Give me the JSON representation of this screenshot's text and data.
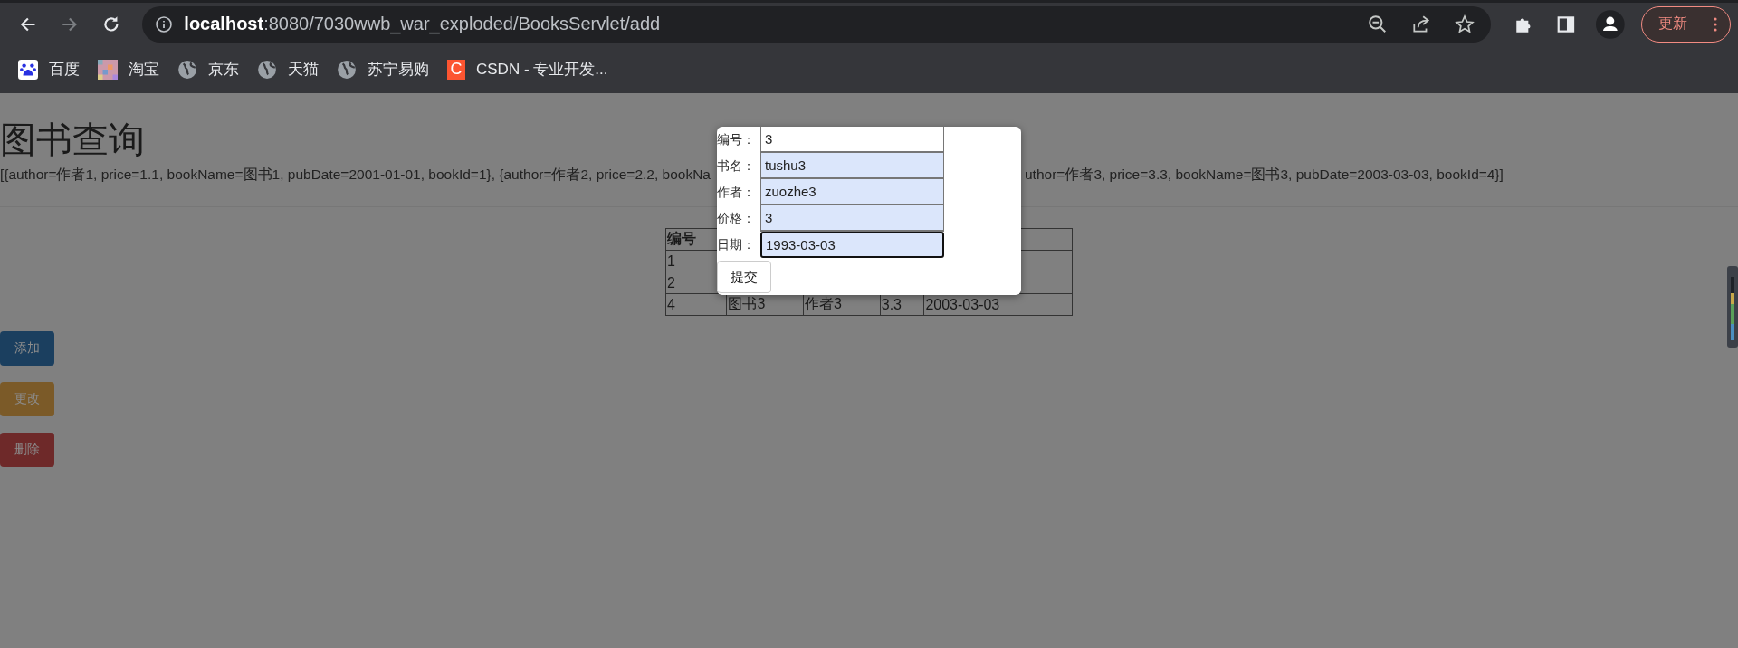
{
  "browser": {
    "nav_buttons": [
      {
        "kind": "back",
        "disabled": false
      },
      {
        "kind": "forward",
        "disabled": true
      },
      {
        "kind": "reload",
        "disabled": false
      }
    ],
    "address": {
      "host": "localhost",
      "path": ":8080/7030wwb_war_exploded/BooksServlet/add"
    },
    "update_button": "更新",
    "bookmarks": [
      {
        "kind": "paw",
        "label": "百度"
      },
      {
        "kind": "mosaic",
        "label": "淘宝"
      },
      {
        "kind": "globe",
        "label": "京东"
      },
      {
        "kind": "globe",
        "label": "天猫"
      },
      {
        "kind": "globe",
        "label": "苏宁易购"
      },
      {
        "kind": "letter",
        "icon_text": "C",
        "label": "CSDN - 专业开发..."
      }
    ]
  },
  "page": {
    "title": "图书查询",
    "list_text_left": "[{author=作者1, price=1.1, bookName=图书1, pubDate=2001-01-01, bookId=1}, {author=作者2, price=2.2, bookNa",
    "list_text_right": "uthor=作者3, price=3.3, bookName=图书3, pubDate=2003-03-03, bookId=4}]",
    "table": {
      "columns": [
        "编号"
      ],
      "rows": [
        {
          "cells": [
            "1"
          ]
        },
        {
          "cells": [
            "2"
          ]
        },
        {
          "cells": [
            "4",
            "图书3",
            "作者3",
            "3.3",
            "2003-03-03"
          ]
        }
      ]
    },
    "action_buttons": [
      {
        "kind": "primary",
        "label": "添加"
      },
      {
        "kind": "warning",
        "label": "更改"
      },
      {
        "kind": "danger",
        "label": "删除"
      }
    ]
  },
  "dialog": {
    "fields": [
      {
        "label": "编号：",
        "value": "3",
        "autofilled": false,
        "focused": false
      },
      {
        "label": "书名：",
        "value": "tushu3",
        "autofilled": true,
        "focused": false
      },
      {
        "label": "作者：",
        "value": "zuozhe3",
        "autofilled": true,
        "focused": false
      },
      {
        "label": "价格：",
        "value": "3",
        "autofilled": true,
        "focused": false
      },
      {
        "label": "日期：",
        "value": "1993-03-03",
        "autofilled": true,
        "focused": true
      }
    ],
    "submit": "提交"
  }
}
